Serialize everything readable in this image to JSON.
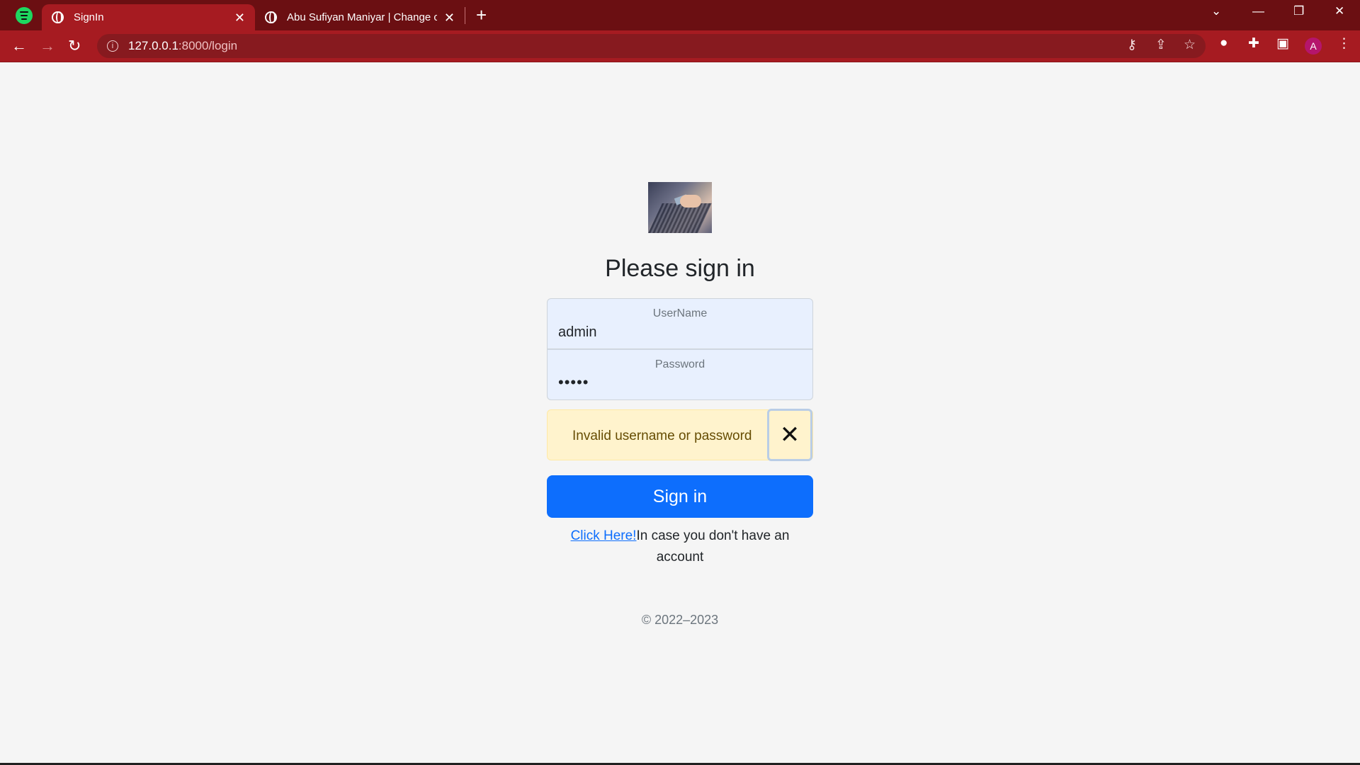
{
  "browser": {
    "tabs": [
      {
        "title": "SignIn",
        "active": true
      },
      {
        "title": "Abu Sufiyan Maniyar | Change co",
        "active": false
      }
    ],
    "url_host": "127.0.0.1",
    "url_path": ":8000/login",
    "profile_initial": "A",
    "new_tab_symbol": "+",
    "close_symbol": "✕",
    "icons": [
      "spotify-icon",
      "globe-icon",
      "back-icon",
      "forward-icon",
      "reload-icon",
      "info-icon",
      "key-icon",
      "share-icon",
      "star-icon",
      "extension-icon",
      "puzzle-icon",
      "sidepanel-icon",
      "menu-icon"
    ],
    "theme_color": "#a61b21"
  },
  "login": {
    "heading": "Please sign in",
    "username_label": "UserName",
    "username_value": "admin",
    "password_label": "Password",
    "password_value": "•••••",
    "alert_text": "Invalid username or password",
    "signin_label": "Sign in",
    "register_link": "Click Here!",
    "register_text": "In case you don't have an account",
    "copyright": "© 2022–2023",
    "primary_color": "#0d6efd",
    "alert_color": "#fff3cd"
  }
}
